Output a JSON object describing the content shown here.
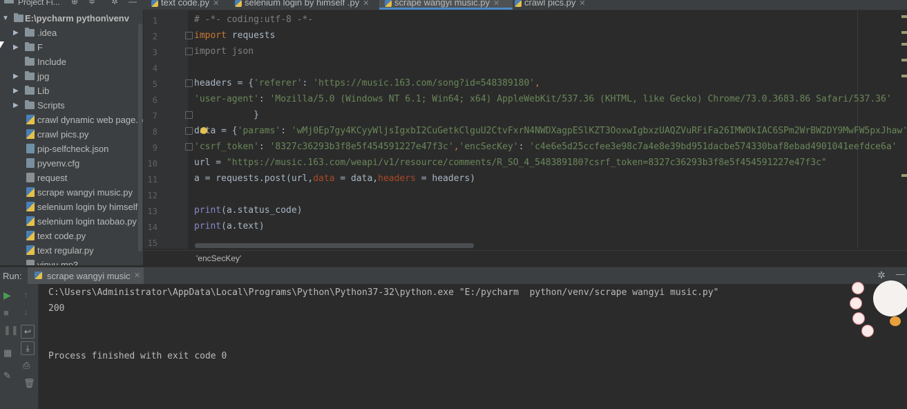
{
  "colors": {
    "accent": "#4a88c7",
    "keyword": "#cc7832",
    "string": "#6a8759",
    "run": "#499c54"
  },
  "top_bar": {
    "project_label": "Project Fi..."
  },
  "tabs": [
    {
      "label": "text code.py",
      "active": false
    },
    {
      "label": "selenium login by himself .py",
      "active": false
    },
    {
      "label": "scrape wangyi music.py",
      "active": true
    },
    {
      "label": "crawl pics.py",
      "active": false
    }
  ],
  "tree": {
    "root": "E:\\pycharm  python\\venv",
    "items": [
      {
        "label": ".idea",
        "type": "folder",
        "expandable": true
      },
      {
        "label": "F",
        "type": "folder",
        "expandable": true
      },
      {
        "label": "Include",
        "type": "folder",
        "expandable": false
      },
      {
        "label": "jpg",
        "type": "folder",
        "expandable": true
      },
      {
        "label": "Lib",
        "type": "folder",
        "expandable": true
      },
      {
        "label": "Scripts",
        "type": "folder",
        "expandable": true
      },
      {
        "label": "crawl dynamic web page.p",
        "type": "py"
      },
      {
        "label": "crawl pics.py",
        "type": "py"
      },
      {
        "label": "pip-selfcheck.json",
        "type": "json"
      },
      {
        "label": "pyvenv.cfg",
        "type": "cfg"
      },
      {
        "label": "request",
        "type": "plain"
      },
      {
        "label": "scrape wangyi music.py",
        "type": "py"
      },
      {
        "label": "selenium login by himself .",
        "type": "py"
      },
      {
        "label": "selenium login taobao.py",
        "type": "py"
      },
      {
        "label": "text code.py",
        "type": "py"
      },
      {
        "label": "text regular.py",
        "type": "py"
      },
      {
        "label": "yinyu.mp3",
        "type": "plain"
      }
    ]
  },
  "editor": {
    "line_numbers": [
      "1",
      "2",
      "3",
      "4",
      "5",
      "6",
      "7",
      "8",
      "9",
      "10",
      "11",
      "12",
      "13",
      "14",
      "15"
    ],
    "lines": {
      "l1": "# -*- coding:utf-8 -*-",
      "l2_kw": "import",
      "l2_rest": " requests",
      "l3": "import json",
      "l5_a": "headers = {",
      "l5_k": "'referer'",
      "l5_b": ": ",
      "l5_v": "'https://music.163.com/song?id=548389180'",
      "l5_c": ",",
      "l6_k": "'user-agent'",
      "l6_b": ": ",
      "l6_v": "'Mozilla/5.0 (Windows NT 6.1; Win64; x64) AppleWebKit/537.36 (KHTML, like Gecko) Chrome/73.0.3683.86 Safari/537.36'",
      "l7": "           }",
      "l8_a": "data = {",
      "l8_k": "'params'",
      "l8_b": ": ",
      "l8_v": "'wMj0Ep7gy4KCyyWljsIgxbI2CuGetkClguU2CtvFxrN4NWDXagpESlKZT3OoxwIgbxzUAQZVuRFiFa26IMWOkIAC6SPm2WrBW2DY9MwFW5pxJhaw'",
      "l9_k": "'csrf_token'",
      "l9_b": ": ",
      "l9_v": "'8327c36293b3f8e5f454591227e47f3c'",
      "l9_c": ",",
      "l9_k2": "'encSecKey'",
      "l9_b2": ": ",
      "l9_v2": "'c4e6e5d25ccfee3e98c7a4e8e39bd951dacbe574330baf8ebad4901041eefdce6a'",
      "l10_a": "url = ",
      "l10_v": "\"https://music.163.com/weapi/v1/resource/comments/R_SO_4_548389180?csrf_token=8327c36293b3f8e5f454591227e47f3c\"",
      "l11_a": "a = requests.post(url,",
      "l11_p1": "data",
      "l11_b": " = data,",
      "l11_p2": "headers",
      "l11_c": " = headers)",
      "l13_f": "print",
      "l13_r": "(a.status_code)",
      "l14_f": "print",
      "l14_r": "(a.text)"
    },
    "breadcrumb": "'encSecKey'"
  },
  "run": {
    "label": "Run:",
    "tab_label": "scrape wangyi music",
    "console": [
      "C:\\Users\\Administrator\\AppData\\Local\\Programs\\Python\\Python37-32\\python.exe \"E:/pycharm  python/venv/scrape wangyi music.py\"",
      "200",
      "",
      "Process finished with exit code 0"
    ]
  }
}
